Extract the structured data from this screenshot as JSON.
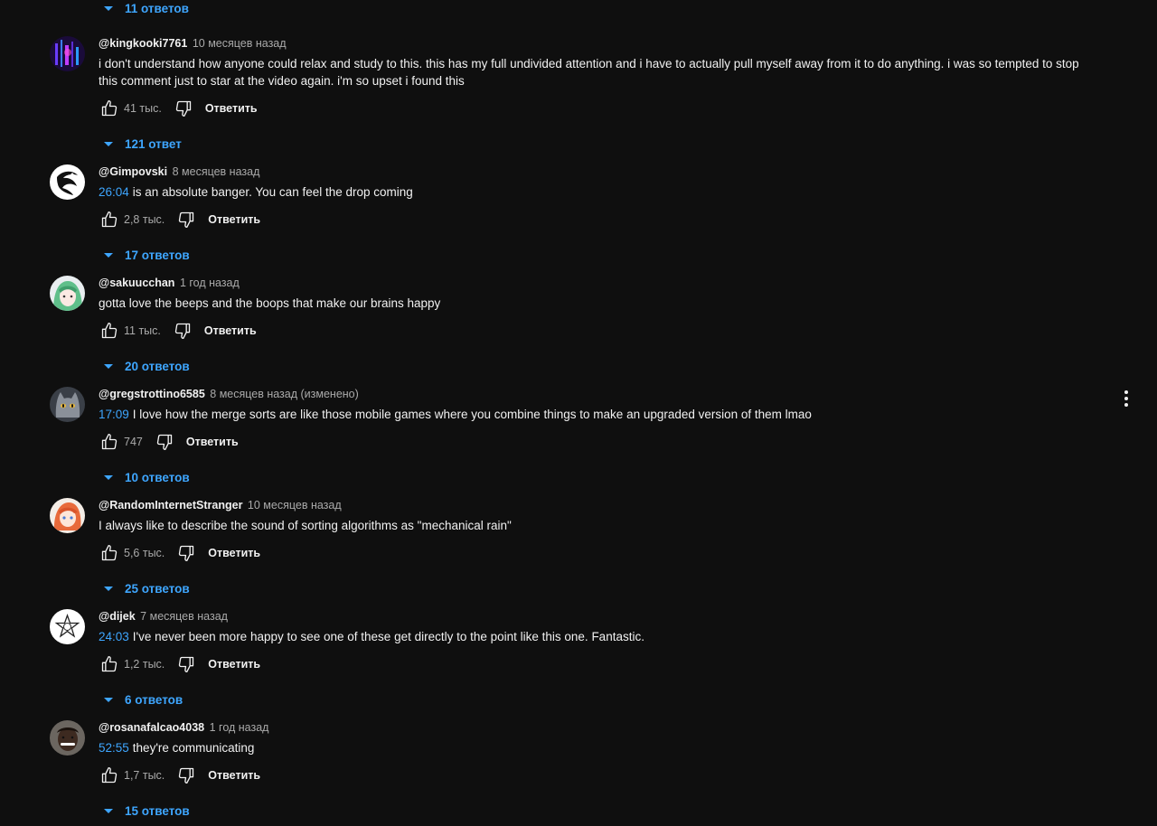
{
  "top_replies_label": "11 ответов",
  "reply_label": "Ответить",
  "comments": [
    {
      "author": "@kingkooki7761",
      "time": "10 месяцев назад",
      "timestamp": "",
      "text": "i don't understand how anyone could relax and study to this. this has my full undivided attention and i have to actually pull myself away from it to do anything. i was so tempted to stop this comment just to star at the video again. i'm so upset i found this",
      "likes": "41 тыс.",
      "replies": "121 ответ",
      "avatar": "neon-purple"
    },
    {
      "author": "@Gimpovski",
      "time": "8 месяцев назад",
      "timestamp": "26:04",
      "text": "is an absolute banger. You can feel the drop coming",
      "likes": "2,8 тыс.",
      "replies": "17 ответов",
      "avatar": "white-dragon"
    },
    {
      "author": "@sakuucchan",
      "time": "1 год назад",
      "timestamp": "",
      "text": "gotta love the beeps and the boops that make our brains happy",
      "likes": "11 тыс.",
      "replies": "20 ответов",
      "avatar": "anime-green-hair"
    },
    {
      "author": "@gregstrottino6585",
      "time": "8 месяцев назад (изменено)",
      "timestamp": "17:09",
      "text": "I love how the merge sorts are like those mobile games where you combine things to make an upgraded version of them lmao",
      "likes": "747",
      "replies": "10 ответов",
      "avatar": "grey-cat"
    },
    {
      "author": "@RandomInternetStranger",
      "time": "10 месяцев назад",
      "timestamp": "",
      "text": "I always like to describe the sound of sorting algorithms as \"mechanical rain\"",
      "likes": "5,6 тыс.",
      "replies": "25 ответов",
      "avatar": "anime-orange-hair"
    },
    {
      "author": "@dijek",
      "time": "7 месяцев назад",
      "timestamp": "24:03",
      "text": "I've never been more happy to see one of these get directly to the point like this one. Fantastic.",
      "likes": "1,2 тыс.",
      "replies": "6 ответов",
      "avatar": "star-outline"
    },
    {
      "author": "@rosanafalcao4038",
      "time": "1 год назад",
      "timestamp": "52:55",
      "text": "they're communicating",
      "likes": "1,7 тыс.",
      "replies": "15 ответов",
      "avatar": "person-photo"
    }
  ],
  "colors": {
    "background": "#0f0f0f",
    "text": "#f1f1f1",
    "secondary": "#aaaaaa",
    "link": "#3ea6ff"
  }
}
